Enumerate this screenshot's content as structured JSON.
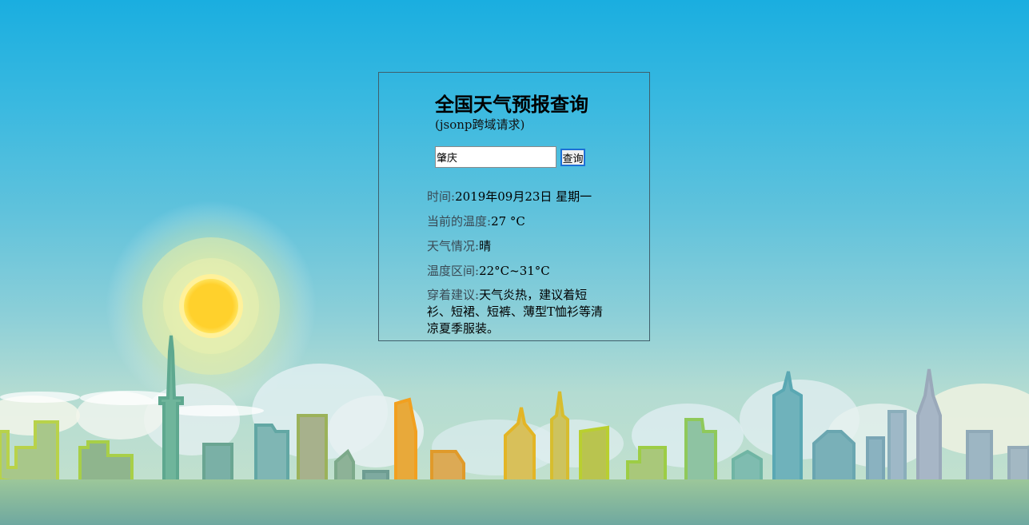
{
  "page": {
    "title": "全国天气预报查询",
    "subtitle": "(jsonp跨域请求)"
  },
  "search": {
    "value": "肇庆",
    "button_label": "查询"
  },
  "result": {
    "time_label": "时间:",
    "time_value": "2019年09月23日 星期一",
    "temp_label": "当前的温度:",
    "temp_value": "27 °C",
    "weather_label": "天气情况:",
    "weather_value": "晴",
    "range_label": "温度区间:",
    "range_value": "22°C~31°C",
    "advice_label": "穿着建议:",
    "advice_value": "天气炎热，建议着短衫、短裙、短裤、薄型T恤衫等清凉夏季服装。"
  },
  "colors": {
    "sky_top": "#1aaee0",
    "sky_bottom": "#c8e2cc",
    "button_border": "#1c6fd6",
    "panel_border": "#3f5f6b"
  }
}
